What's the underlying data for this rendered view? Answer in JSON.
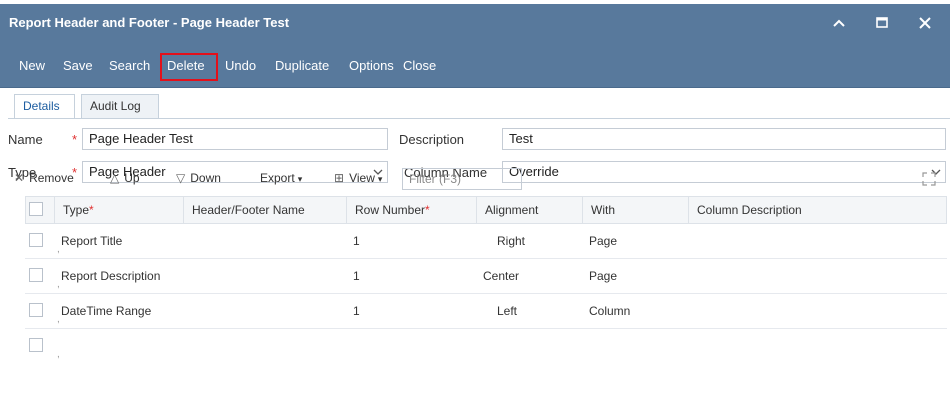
{
  "window": {
    "title": "Report Header and Footer - Page Header Test",
    "controls": [
      "collapse",
      "maximize",
      "close"
    ]
  },
  "toolbar": {
    "new": "New",
    "save": "Save",
    "search": "Search",
    "delete": "Delete",
    "undo": "Undo",
    "duplicate": "Duplicate",
    "options": "Options",
    "close": "Close"
  },
  "tabs": {
    "details": "Details",
    "audit_log": "Audit Log"
  },
  "form": {
    "name_label": "Name",
    "name_value": "Page Header Test",
    "description_label": "Description",
    "description_value": "Test",
    "type_label": "Type",
    "type_value": "Page Header",
    "column_name_label": "Column Name",
    "column_name_value": "Override"
  },
  "grid_toolbar": {
    "remove": "Remove",
    "up": "Up",
    "down": "Down",
    "export": "Export",
    "view": "View",
    "filter_placeholder": "Filter (F3)"
  },
  "grid": {
    "columns": [
      "Type",
      "Header/Footer Name",
      "Row Number",
      "Alignment",
      "With",
      "Column Description"
    ],
    "rows": [
      {
        "type": "Report Title",
        "name": "",
        "row_number": "1",
        "alignment": "Right",
        "with": "Page",
        "description": ""
      },
      {
        "type": "Report Description",
        "name": "",
        "row_number": "1",
        "alignment": "Center",
        "with": "Page",
        "description": ""
      },
      {
        "type": "DateTime Range",
        "name": "",
        "row_number": "1",
        "alignment": "Left",
        "with": "Column",
        "description": ""
      }
    ]
  },
  "colors": {
    "header_blue": "#58799c",
    "highlight_red": "#e3101a",
    "required_red": "#e03030"
  }
}
